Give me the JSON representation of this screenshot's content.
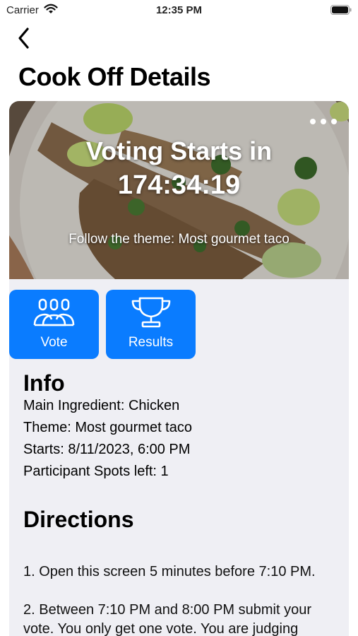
{
  "status_bar": {
    "carrier": "Carrier",
    "time": "12:35 PM"
  },
  "header": {
    "title": "Cook Off Details"
  },
  "hero": {
    "countdown_label": "Voting Starts in",
    "countdown_time": "174:34:19",
    "theme_text": "Follow the theme: Most gourmet taco"
  },
  "actions": [
    {
      "label": "Vote",
      "icon": "people-group-icon"
    },
    {
      "label": "Results",
      "icon": "trophy-icon"
    }
  ],
  "info": {
    "title": "Info",
    "lines": [
      "Main Ingredient: Chicken",
      "Theme: Most gourmet taco",
      "Starts: 8/11/2023, 6:00 PM",
      "Participant Spots left: 1"
    ]
  },
  "directions": {
    "title": "Directions",
    "step1": "1. Open this screen 5 minutes before 7:10 PM.",
    "step2_line1": "2. Between 7:10 PM and 8:00 PM submit your",
    "step2_line2": "vote. You only get one vote. You are judging"
  },
  "colors": {
    "accent": "#0a7cff",
    "card_bg": "#efeff4"
  }
}
